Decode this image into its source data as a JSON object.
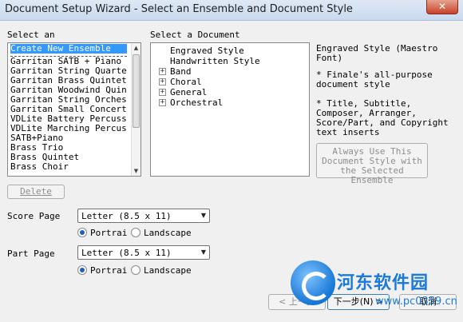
{
  "window": {
    "title": "Document Setup Wizard - Select an Ensemble and Document Style",
    "close_glyph": "✕"
  },
  "ensemble": {
    "label": "Select an",
    "items": [
      "Create New Ensemble",
      "Garritan SATB + Piano",
      "Garritan String Quartet",
      "Garritan Brass Quintet",
      "Garritan Woodwind Quintet",
      "Garritan String Orchestra",
      "Garritan Small Concert Ba",
      "VDLite Battery Percussion",
      "VDLite Marching Percussio",
      "SATB+Piano",
      "Brass Trio",
      "Brass Quintet",
      "Brass Choir"
    ],
    "selected_index": 0,
    "delete_label": "Delete"
  },
  "document": {
    "label": "Select a Document",
    "items": [
      {
        "label": "Engraved Style",
        "expandable": false
      },
      {
        "label": "Handwritten Style",
        "expandable": false
      },
      {
        "label": "Band",
        "expandable": true
      },
      {
        "label": "Choral",
        "expandable": true
      },
      {
        "label": "General",
        "expandable": true
      },
      {
        "label": "Orchestral",
        "expandable": true
      }
    ],
    "expander_glyph": "+"
  },
  "description": {
    "title": "Engraved Style (Maestro Font)",
    "line1": "* Finale's all-purpose document style",
    "line2": "* Title, Subtitle, Composer, Arranger, Score/Part, and Copyright text inserts",
    "always_use_button": "Always Use This Document Style with the Selected Ensemble"
  },
  "score_page": {
    "label": "Score Page",
    "size": "Letter (8.5 x 11)",
    "portrait": "Portrai",
    "landscape": "Landscape",
    "orientation": "portrait"
  },
  "part_page": {
    "label": "Part Page",
    "size": "Letter (8.5 x 11)",
    "portrait": "Portrai",
    "landscape": "Landscape",
    "orientation": "portrait"
  },
  "footer": {
    "back": "< 上一步",
    "next": "下一步(N) >",
    "cancel": "取消"
  },
  "watermark": {
    "text": "河东软件园",
    "url": "www.pc0359.cn"
  }
}
